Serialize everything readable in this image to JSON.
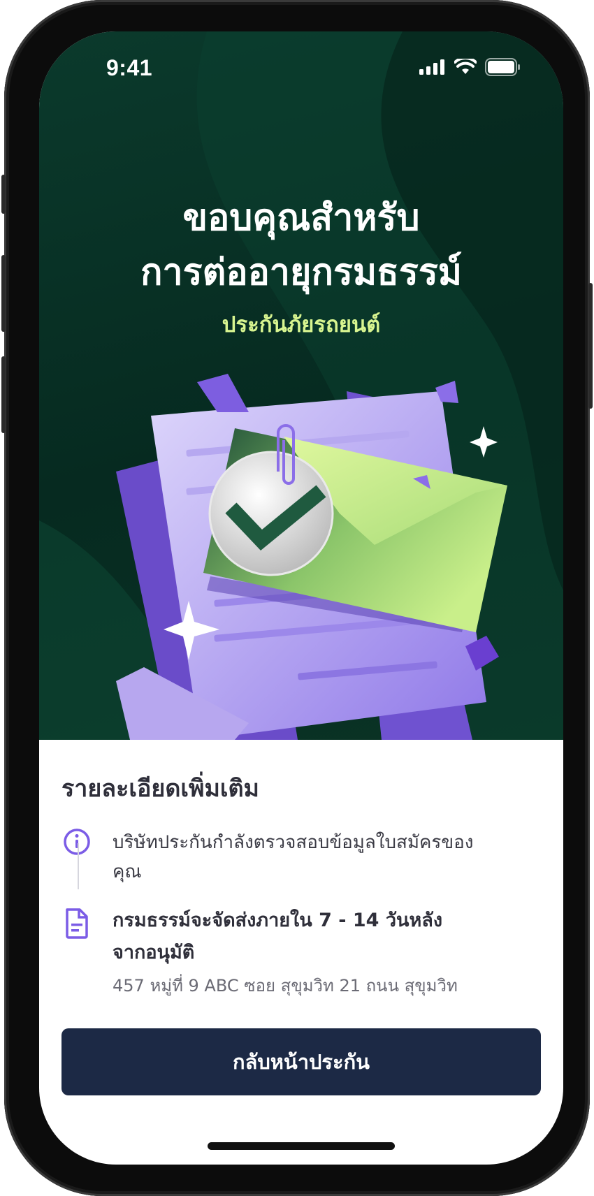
{
  "status_bar": {
    "time": "9:41"
  },
  "hero": {
    "title_line1": "ขอบคุณสำหรับ",
    "title_line2": "การต่ออายุกรมธรรม์",
    "subtitle": "ประกันภัยรถยนต์"
  },
  "details": {
    "heading": "รายละเอียดเพิ่มเติม",
    "info_line1": "บริษัทประกันกำลังตรวจสอบข้อมูลใบสมัครของ",
    "info_line2": "คุณ",
    "policy_line1": "กรมธรรม์จะจัดส่งภายใน 7 - 14 วันหลัง",
    "policy_line2": "จากอนุมัติ",
    "address": "457 หมู่ที่ 9 ABC ซอย สุขุมวิท 21 ถนน สุขุมวิท"
  },
  "cta": {
    "label": "กลับหน้าประกัน"
  },
  "colors": {
    "hero_bg": "#062a20",
    "accent_green": "#d8f590",
    "accent_purple": "#7b5ce6",
    "button_bg": "#1c2945"
  },
  "icons": {
    "info": "info-circle-icon",
    "document": "document-icon",
    "signal": "signal-icon",
    "wifi": "wifi-icon",
    "battery": "battery-icon"
  }
}
